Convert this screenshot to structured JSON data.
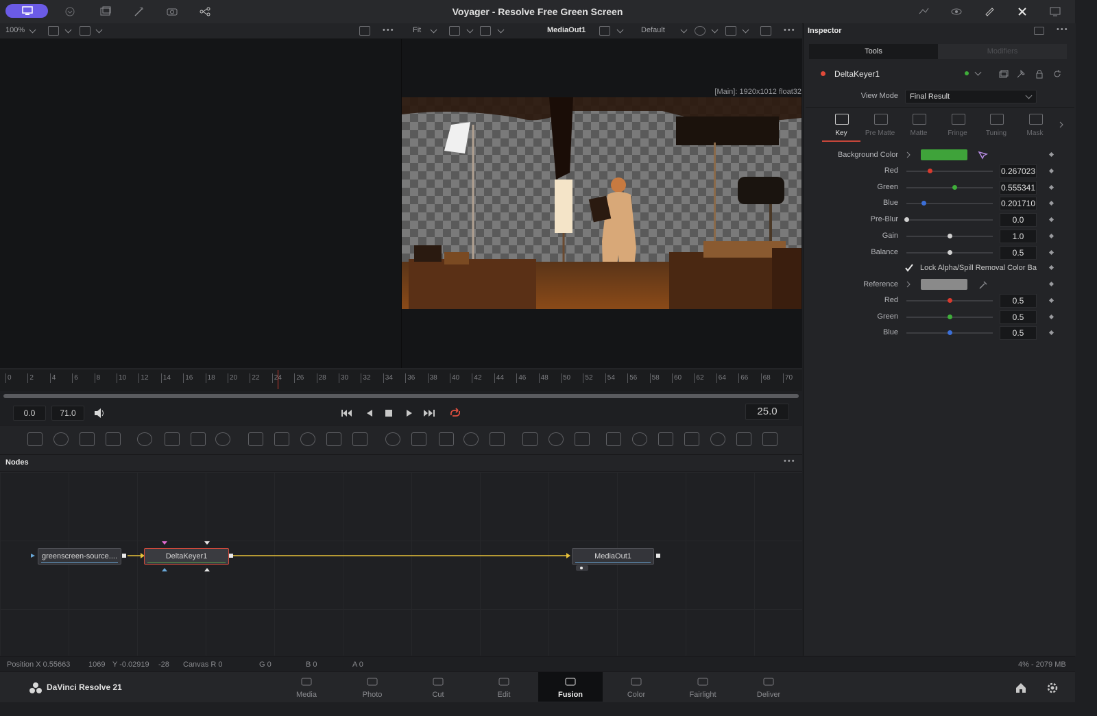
{
  "window": {
    "title": "Voyager - Resolve Free Green Screen"
  },
  "viewer_toolbar": {
    "zoom": "100%",
    "fit": "Fit",
    "output_label": "MediaOut1",
    "lut_label": "Default"
  },
  "viewer": {
    "resolution_info": "[Main]: 1920x1012 float32"
  },
  "timeline": {
    "tick_labels": [
      "0",
      "2",
      "4",
      "6",
      "8",
      "10",
      "12",
      "14",
      "16",
      "18",
      "20",
      "22",
      "24",
      "26",
      "28",
      "30",
      "32",
      "34",
      "36",
      "38",
      "40",
      "42",
      "44",
      "46",
      "48",
      "50",
      "52",
      "54",
      "56",
      "58",
      "60",
      "62",
      "64",
      "66",
      "68",
      "70"
    ],
    "playhead_frame": 24.5
  },
  "transport": {
    "start_time": "0.0",
    "end_time": "71.0",
    "current_frame": "25.0"
  },
  "nodes": {
    "title": "Nodes",
    "items": [
      {
        "label": "greenscreen-source...."
      },
      {
        "label": "DeltaKeyer1"
      },
      {
        "label": "MediaOut1"
      }
    ]
  },
  "status_bar": {
    "position": "Position  X 0.55663",
    "px": "1069",
    "y": "Y -0.02919",
    "py": "-28",
    "canvas_r": "Canvas  R 0",
    "g": "G 0",
    "b": "B 0",
    "a": "A 0",
    "memory": "4% - 2079 MB"
  },
  "app": {
    "name": "DaVinci Resolve 21"
  },
  "pages": [
    {
      "label": "Media",
      "icon": "media-icon"
    },
    {
      "label": "Photo",
      "icon": "photo-icon"
    },
    {
      "label": "Cut",
      "icon": "cut-icon"
    },
    {
      "label": "Edit",
      "icon": "edit-icon"
    },
    {
      "label": "Fusion",
      "icon": "fusion-icon",
      "active": true
    },
    {
      "label": "Color",
      "icon": "color-icon"
    },
    {
      "label": "Fairlight",
      "icon": "fairlight-icon"
    },
    {
      "label": "Deliver",
      "icon": "deliver-icon"
    }
  ],
  "inspector": {
    "title": "Inspector",
    "tabs": [
      "Tools",
      "Modifiers"
    ],
    "node_name": "DeltaKeyer1",
    "view_mode_label": "View Mode",
    "view_mode_value": "Final Result",
    "subtabs": [
      "Key",
      "Pre Matte",
      "Matte",
      "Fringe",
      "Tuning",
      "Mask"
    ],
    "background_color_label": "Background Color",
    "background_color_hex": "#3fa33a",
    "rows": [
      {
        "label": "Red",
        "value": "0.267023",
        "fraction": 0.267,
        "color": "#d93a2e"
      },
      {
        "label": "Green",
        "value": "0.555341",
        "fraction": 0.555,
        "color": "#3fae3a"
      },
      {
        "label": "Blue",
        "value": "0.201710",
        "fraction": 0.2,
        "color": "#3b6fd8"
      },
      {
        "label": "Pre-Blur",
        "value": "0.0",
        "fraction": 0.0,
        "color": "#d0d0d0"
      },
      {
        "label": "Gain",
        "value": "1.0",
        "fraction": 0.5,
        "color": "#d0d0d0"
      },
      {
        "label": "Balance",
        "value": "0.5",
        "fraction": 0.5,
        "color": "#d0d0d0"
      }
    ],
    "lock_label": "Lock Alpha/Spill Removal Color Bal",
    "lock_checked": true,
    "reference_label": "Reference",
    "reference_color_hex": "#8a8a8a",
    "ref_rows": [
      {
        "label": "Red",
        "value": "0.5",
        "fraction": 0.5,
        "color": "#d93a2e"
      },
      {
        "label": "Green",
        "value": "0.5",
        "fraction": 0.5,
        "color": "#3fae3a"
      },
      {
        "label": "Blue",
        "value": "0.5",
        "fraction": 0.5,
        "color": "#3b6fd8"
      }
    ]
  }
}
